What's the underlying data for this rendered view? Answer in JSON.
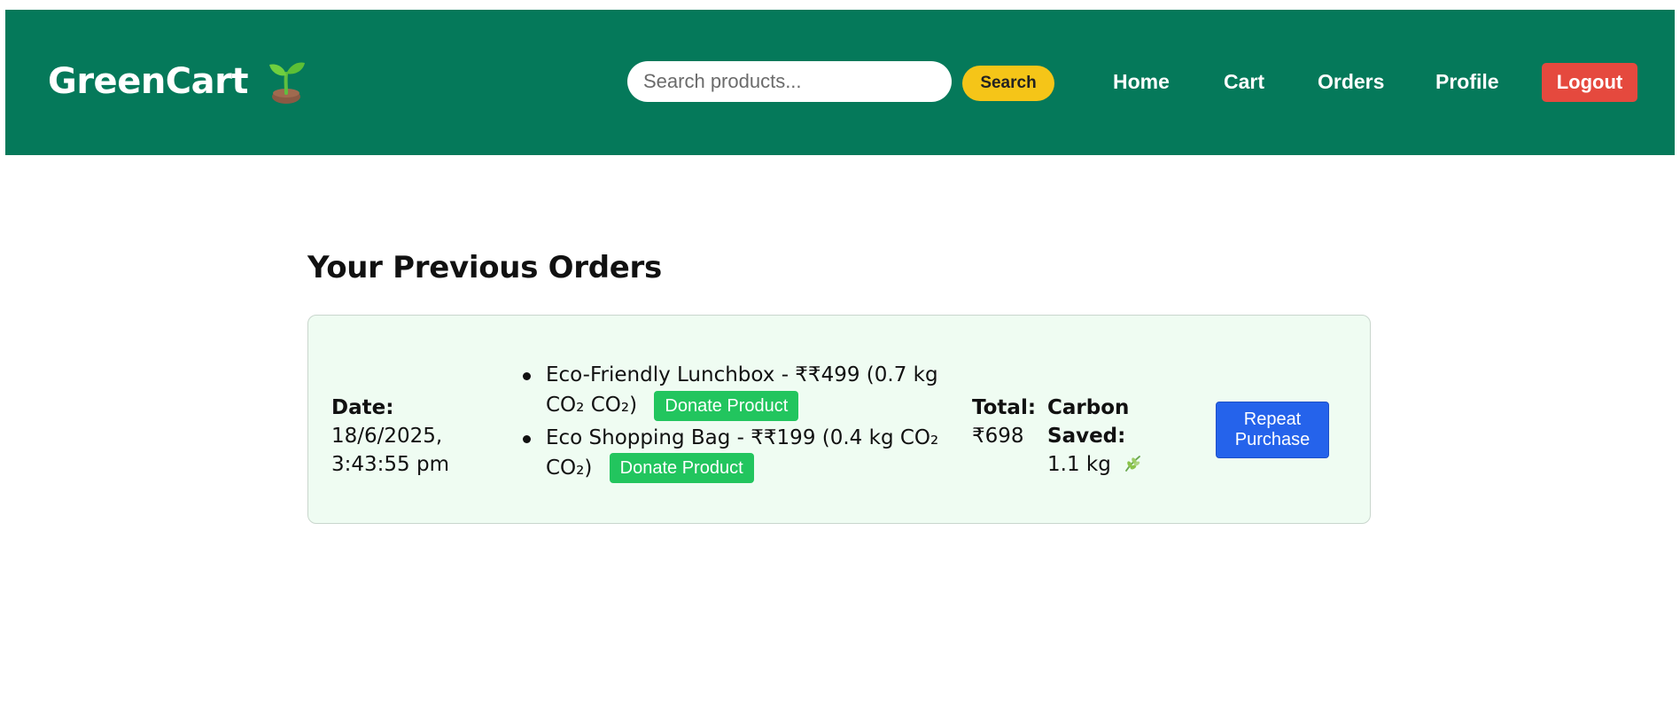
{
  "header": {
    "brand": "GreenCart",
    "search": {
      "placeholder": "Search products...",
      "button_label": "Search"
    },
    "nav": [
      "Home",
      "Cart",
      "Orders",
      "Profile"
    ],
    "logout_label": "Logout"
  },
  "main": {
    "title": "Your Previous Orders",
    "orders": [
      {
        "date_label": "Date:",
        "date_value": "18/6/2025, 3:43:55 pm",
        "items": [
          {
            "text": "Eco-Friendly Lunchbox - ₹₹499 (0.7 kg CO₂ CO₂)",
            "donate_label": "Donate Product"
          },
          {
            "text": "Eco Shopping Bag - ₹₹199 (0.4 kg CO₂ CO₂)",
            "donate_label": "Donate Product"
          }
        ],
        "total_label": "Total:",
        "total_value": "₹698",
        "carbon_label": "Carbon Saved:",
        "carbon_value": "1.1 kg",
        "repeat_label": "Repeat Purchase"
      }
    ]
  },
  "colors": {
    "header_bg": "#05795a",
    "search_button": "#f5c518",
    "logout_button": "#e5493e",
    "donate_button": "#22c55e",
    "repeat_button": "#2563eb",
    "card_bg": "#effcf2"
  },
  "icons": {
    "brand": "seedling-icon",
    "carbon": "herb-leaf-icon"
  }
}
